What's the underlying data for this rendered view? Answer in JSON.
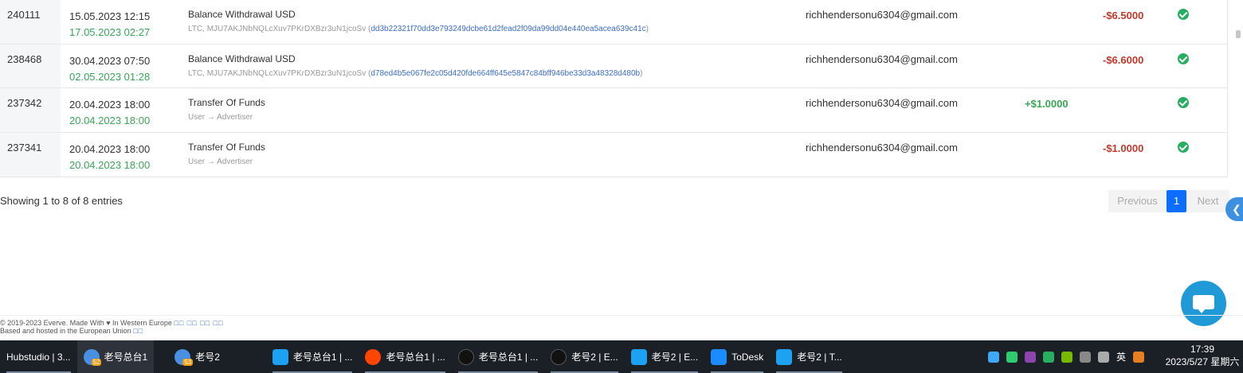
{
  "transactions": [
    {
      "id": "240111",
      "date_created": "15.05.2023 12:15",
      "date_completed": "17.05.2023 02:27",
      "title": "Balance Withdrawal USD",
      "sub_prefix": "LTC, MJU7AKJNbNQLcXuv7PKrDXBzr3uN1jcoSv (",
      "hash": "dd3b22321f70dd3e793249dcbe61d2fead2f09da99dd04e440ea5acea639c41c",
      "sub_suffix": ")",
      "email": "richhendersonu6304@gmail.com",
      "credit": "",
      "debit": "-$6.5000",
      "status": "completed"
    },
    {
      "id": "238468",
      "date_created": "30.04.2023 07:50",
      "date_completed": "02.05.2023 01:28",
      "title": "Balance Withdrawal USD",
      "sub_prefix": "LTC, MJU7AKJNbNQLcXuv7PKrDXBzr3uN1jcoSv (",
      "hash": "d78ed4b5e067fe2c05d420fde664ff645e5847c84bff946be33d3a48328d480b",
      "sub_suffix": ")",
      "email": "richhendersonu6304@gmail.com",
      "credit": "",
      "debit": "-$6.6000",
      "status": "completed"
    },
    {
      "id": "237342",
      "date_created": "20.04.2023 18:00",
      "date_completed": "20.04.2023 18:00",
      "title": "Transfer Of Funds",
      "sub_prefix": "User → Advertiser",
      "hash": "",
      "sub_suffix": "",
      "email": "richhendersonu6304@gmail.com",
      "credit": "+$1.0000",
      "debit": "",
      "status": "completed"
    },
    {
      "id": "237341",
      "date_created": "20.04.2023 18:00",
      "date_completed": "20.04.2023 18:00",
      "title": "Transfer Of Funds",
      "sub_prefix": "User → Advertiser",
      "hash": "",
      "sub_suffix": "",
      "email": "richhendersonu6304@gmail.com",
      "credit": "",
      "debit": "-$1.0000",
      "status": "completed"
    }
  ],
  "pagination": {
    "showing": "Showing 1 to 8 of 8 entries",
    "previous": "Previous",
    "current_page": "1",
    "next": "Next"
  },
  "side_tab": {
    "icon": "chevron-left-icon",
    "glyph": "❮"
  },
  "chat_widget": {
    "icon": "chat-bubble-icon"
  },
  "footer": {
    "line1": "© 2019-2023 Everve. Made With ♥ In Western Europe",
    "line1_links": "□□ □□ □□ □□",
    "line2": "Based and hosted in the European Union",
    "line2_links": "□□"
  },
  "taskbar": {
    "items": [
      {
        "label": "Hubstudio | 3...",
        "icon": "",
        "badge": ""
      },
      {
        "label": "老号总台1",
        "icon": "globe",
        "badge": "52",
        "active": true
      },
      {
        "label": "老号2",
        "icon": "globe",
        "badge": "53"
      },
      {
        "label": "老号总台1    |   ...",
        "icon": "twitter"
      },
      {
        "label": "老号总台1    |   ...",
        "icon": "reddit"
      },
      {
        "label": "老号总台1    |   ...",
        "icon": "tiktok"
      },
      {
        "label": "老号2    |    E...",
        "icon": "tiktok"
      },
      {
        "label": "老号2    |    E...",
        "icon": "twitter"
      },
      {
        "label": "ToDesk",
        "icon": "todesk"
      },
      {
        "label": "老号2    |    T...",
        "icon": "twitter"
      }
    ],
    "tray_ime": "英",
    "clock_time": "17:39",
    "clock_date": "2023/5/27 星期六"
  },
  "colors": {
    "credit": "#3aa757",
    "debit": "#c0392b",
    "accent": "#0d6efd",
    "chat": "#1f9ad6"
  }
}
